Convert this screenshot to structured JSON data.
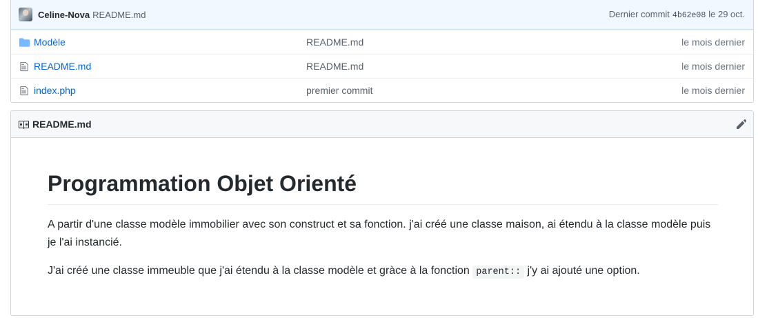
{
  "commit_bar": {
    "author": "Celine-Nova",
    "message": "README.md",
    "last_commit_label": "Dernier commit",
    "sha": "4b62e08",
    "date": "le 29 oct."
  },
  "files": [
    {
      "name": "Modèle",
      "type": "folder",
      "commit": "README.md",
      "age": "le mois dernier"
    },
    {
      "name": "README.md",
      "type": "file",
      "commit": "README.md",
      "age": "le mois dernier"
    },
    {
      "name": "index.php",
      "type": "file",
      "commit": "premier commit",
      "age": "le mois dernier"
    }
  ],
  "readme": {
    "header_title": "README.md",
    "heading": "Programmation Objet Orienté",
    "paragraph1": "A partir d'une classe modèle immobilier avec son construct et sa fonction. j'ai créé une classe maison, ai étendu à la classe modèle puis je l'ai instancié.",
    "paragraph2_before": "J'ai créé une classe immeuble que j'ai étendu à la classe modèle et gràce à la fonction",
    "paragraph2_code": "parent::",
    "paragraph2_after": "j'y ai ajouté une option."
  },
  "icons": {
    "folder": "folder-icon",
    "file": "file-icon",
    "book": "book-icon",
    "edit": "pencil-icon"
  },
  "colors": {
    "link": "#0366d6",
    "commit_bar_bg": "#f1f8ff",
    "folder_icon": "#79b8ff"
  }
}
